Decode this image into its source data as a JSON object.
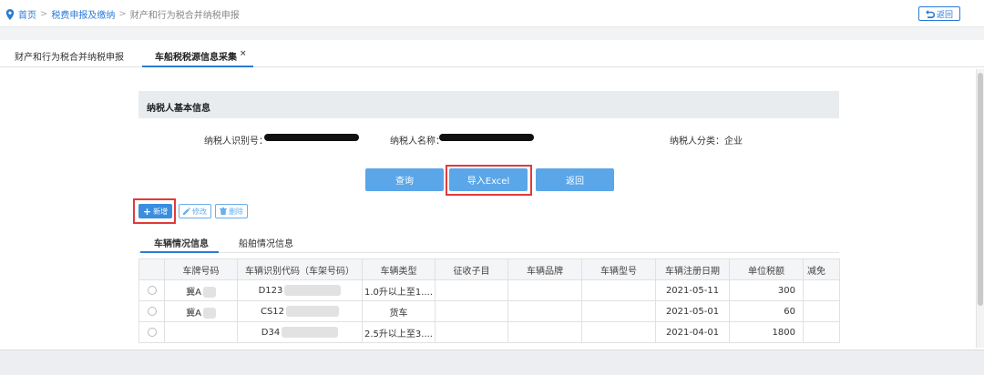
{
  "breadcrumb": {
    "home": "首页",
    "level1": "税费申报及缴纳",
    "level2": "财产和行为税合并纳税申报",
    "sep": ">"
  },
  "top_back": "返回",
  "tabs": [
    {
      "label": "财产和行为税合并纳税申报"
    },
    {
      "label": "车船税税源信息采集",
      "close": "×"
    }
  ],
  "section": {
    "title": "纳税人基本信息"
  },
  "info": {
    "id_label": "纳税人识别号：",
    "name_label": "纳税人名称：",
    "category": "纳税人分类：企业"
  },
  "actions": {
    "query": "查询",
    "import": "导入Excel",
    "back": "返回"
  },
  "toolbar": {
    "add": "新增",
    "edit": "修改",
    "delete": "删除"
  },
  "subtabs": [
    "车辆情况信息",
    "船舶情况信息"
  ],
  "table": {
    "headers": [
      "",
      "车牌号码",
      "车辆识别代码（车架号码）",
      "车辆类型",
      "征收子目",
      "车辆品牌",
      "车辆型号",
      "车辆注册日期",
      "单位税额",
      "减免"
    ],
    "rows": [
      {
        "plate": "冀A",
        "vin": "D123",
        "type": "1.0升以上至1....",
        "date": "2021-05-11",
        "amount": "300"
      },
      {
        "plate": "冀A",
        "vin": "CS12",
        "type": "货车",
        "date": "2021-05-01",
        "amount": "60"
      },
      {
        "plate": "",
        "vin": "D34",
        "type": "2.5升以上至3....",
        "date": "2021-04-01",
        "amount": "1800"
      }
    ]
  }
}
